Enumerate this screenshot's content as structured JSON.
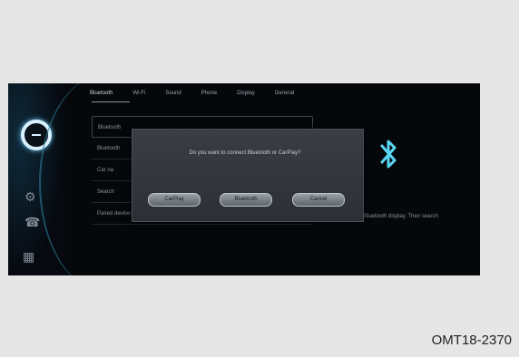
{
  "tabs": [
    {
      "label": "Bluetooth"
    },
    {
      "label": "Wi-Fi"
    },
    {
      "label": "Sound"
    },
    {
      "label": "Phone"
    },
    {
      "label": "Display"
    },
    {
      "label": "General"
    }
  ],
  "list_rows": [
    {
      "label": "Bluetooth"
    },
    {
      "label": "Bluetooth"
    },
    {
      "label": "Car na"
    },
    {
      "label": "Search"
    },
    {
      "label": "Paired devices"
    }
  ],
  "dialog": {
    "message": "Do you want to connect Bluetooth or CarPlay?",
    "buttons": [
      {
        "label": "CarPlay"
      },
      {
        "label": "Bluetooth"
      },
      {
        "label": "Cancel"
      }
    ]
  },
  "bluetooth_caption": "Bluetooth display. Then search",
  "figure_id": "OMT18-2370",
  "colors": {
    "screen_bg": "#05070b",
    "bluetooth_glow": "#59d6f2",
    "dialog_bg": "#33373c"
  },
  "icons": [
    "assistant-icon",
    "settings-icon",
    "phone-icon",
    "apps-icon",
    "bluetooth-icon"
  ]
}
